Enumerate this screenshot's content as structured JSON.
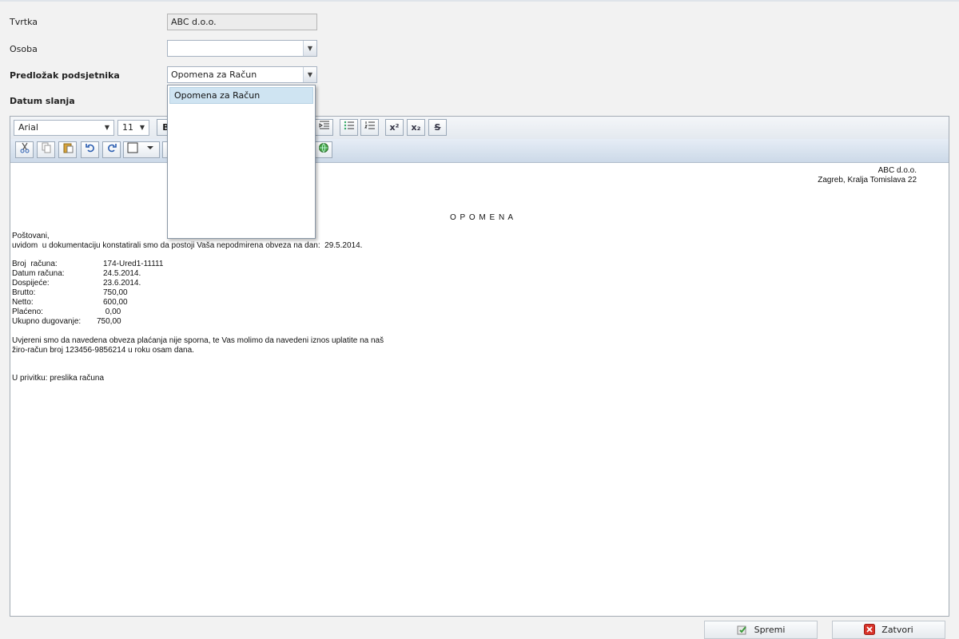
{
  "form": {
    "company_label": "Tvrtka",
    "company_value": "ABC d.o.o.",
    "person_label": "Osoba",
    "person_value": "",
    "template_label": "Predložak podsjetnika",
    "template_value": "Opomena za Račun",
    "send_date_label": "Datum slanja"
  },
  "dropdown": {
    "options": [
      "Opomena za Račun"
    ]
  },
  "toolbar": {
    "font_family": "Arial",
    "font_size": "11",
    "bold_label": "B",
    "superscript_label": "x²",
    "subscript_label": "x₂",
    "strike_label": "S"
  },
  "document": {
    "sender_name": "ABC d.o.o.",
    "sender_address": "Zagreb, Kralja Tomislava 22",
    "title": "O P O M E N A",
    "greeting": "Poštovani,",
    "intro": "uvidom  u dokumentaciju konstatirali smo da postoji Vaša nepodmirena obveza na dan:  29.5.2014.",
    "fields": [
      {
        "label": "Broj  računa:",
        "value": "174-Ured1-11111"
      },
      {
        "label": "Datum računa:",
        "value": "24.5.2014."
      },
      {
        "label": "Dospijeće:",
        "value": "23.6.2014."
      },
      {
        "label": "Brutto:",
        "value": "750,00"
      },
      {
        "label": "Netto:",
        "value": "600,00"
      },
      {
        "label": "Plaćeno:",
        "value": " 0,00"
      },
      {
        "label": "Ukupno dugovanje:",
        "value": "750,00"
      }
    ],
    "body_line1": "Uvjereni smo da navedena obveza plaćanja nije sporna, te Vas molimo da navedeni iznos uplatite na naš",
    "body_line2": "žiro-račun broj 123456-9856214 u roku osam dana.",
    "attachment": "U privitku: preslika računa"
  },
  "footer": {
    "save_label": "Spremi",
    "close_label": "Zatvori"
  }
}
